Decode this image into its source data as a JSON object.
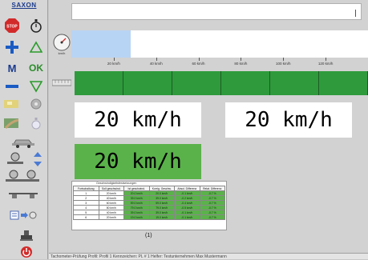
{
  "app": {
    "logo": "SAXON"
  },
  "sidebar": {
    "stop_label": "STOP",
    "ok_label": "OK",
    "m_label": "M"
  },
  "speed_bar": {
    "progress_kmh": 28,
    "max_kmh": 140,
    "ticks": [
      {
        "value": 20,
        "label": "20 km/h"
      },
      {
        "value": 40,
        "label": "40 km/h"
      },
      {
        "value": 60,
        "label": "60 km/h"
      },
      {
        "value": 80,
        "label": "80 km/h"
      },
      {
        "value": 100,
        "label": "100 km/h"
      },
      {
        "value": 120,
        "label": "120 km/h"
      }
    ]
  },
  "segments": {
    "count": 6,
    "color": "#2e9a3c"
  },
  "displays": {
    "primary": "20 km/h",
    "secondary": "20 km/h",
    "highlight": "20 km/h"
  },
  "table": {
    "title": "Geschwindigkeitsfestsetzungen",
    "headers": [
      "Fortschaltung",
      "Soll geschwind.",
      "Ist geschwind.",
      "Korrig. Geschw.",
      "Absol. Differenz",
      "Relat. Differenz"
    ],
    "rows": [
      [
        "1",
        "20 km/h",
        "20.0 km/h",
        "20.0 km/h",
        "-0.1 km/h",
        "-0.7 %"
      ],
      [
        "2",
        "40 km/h",
        "39.0 km/h",
        "39.0 km/h",
        "-0.2 km/h",
        "-0.7 %"
      ],
      [
        "3",
        "60 km/h",
        "59.0 km/h",
        "59.0 km/h",
        "-0.4 km/h",
        "-0.7 %"
      ],
      [
        "4",
        "80 km/h",
        "79.0 km/h",
        "79.0 km/h",
        "-0.5 km/h",
        "-0.7 %"
      ],
      [
        "5",
        "40 km/h",
        "39.0 km/h",
        "39.0 km/h",
        "-0.1 km/h",
        "-0.7 %"
      ],
      [
        "6",
        "20 km/h",
        "19.0 km/h",
        "19.0 km/h",
        "-0.1 km/h",
        "-0.7 %"
      ]
    ],
    "caption": "(1)"
  },
  "status": {
    "text": "Tachometer-Prüfung   Profil: Profil 1   Kennzeichen: PL # 1   Helfer: Testunternehmen Max Mustermann"
  },
  "colors": {
    "green_segment": "#2e9a3c",
    "highlight_display": "#5ab24a",
    "speed_fill": "#b8d4f4",
    "brand_blue": "#1a3a8c"
  }
}
